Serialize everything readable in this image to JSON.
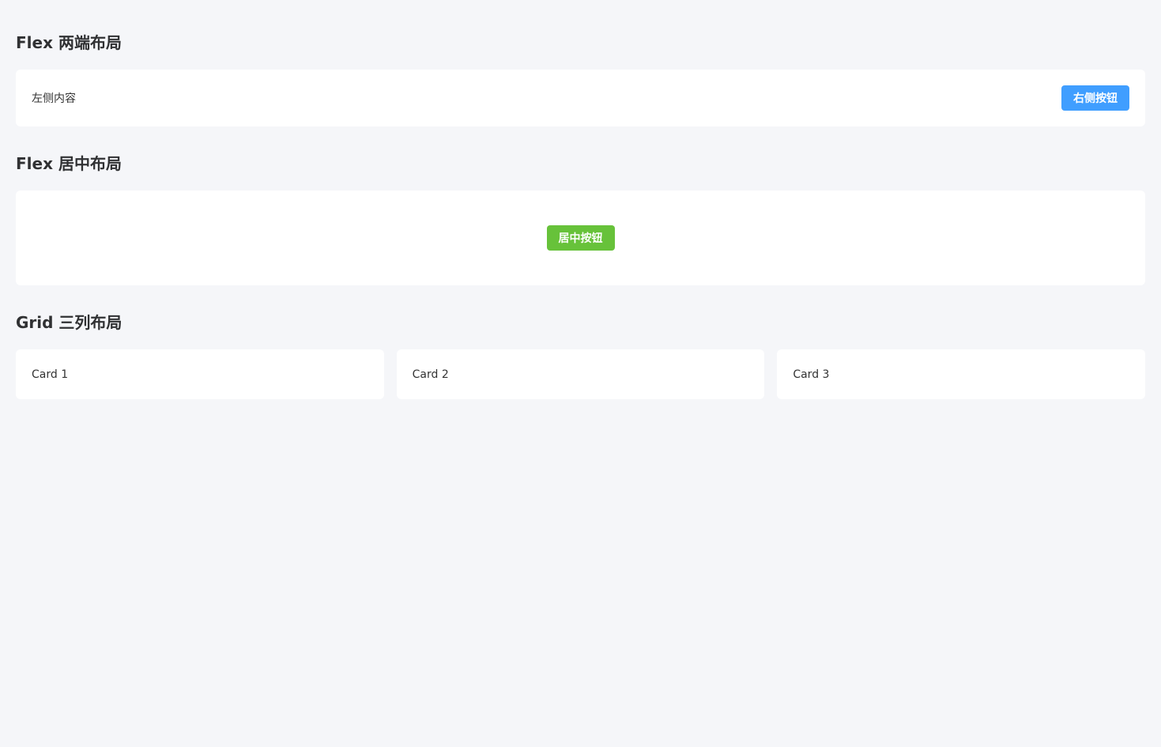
{
  "sections": {
    "split": {
      "title": "Flex 两端布局",
      "left_text": "左侧内容",
      "button_label": "右侧按钮"
    },
    "center": {
      "title": "Flex 居中布局",
      "button_label": "居中按钮"
    },
    "grid": {
      "title": "Grid 三列布局",
      "cards": [
        {
          "label": "Card 1"
        },
        {
          "label": "Card 2"
        },
        {
          "label": "Card 3"
        }
      ]
    }
  },
  "colors": {
    "background": "#f5f6f9",
    "card": "#ffffff",
    "primary": "#409eff",
    "success": "#67c23a",
    "text": "#333333"
  }
}
